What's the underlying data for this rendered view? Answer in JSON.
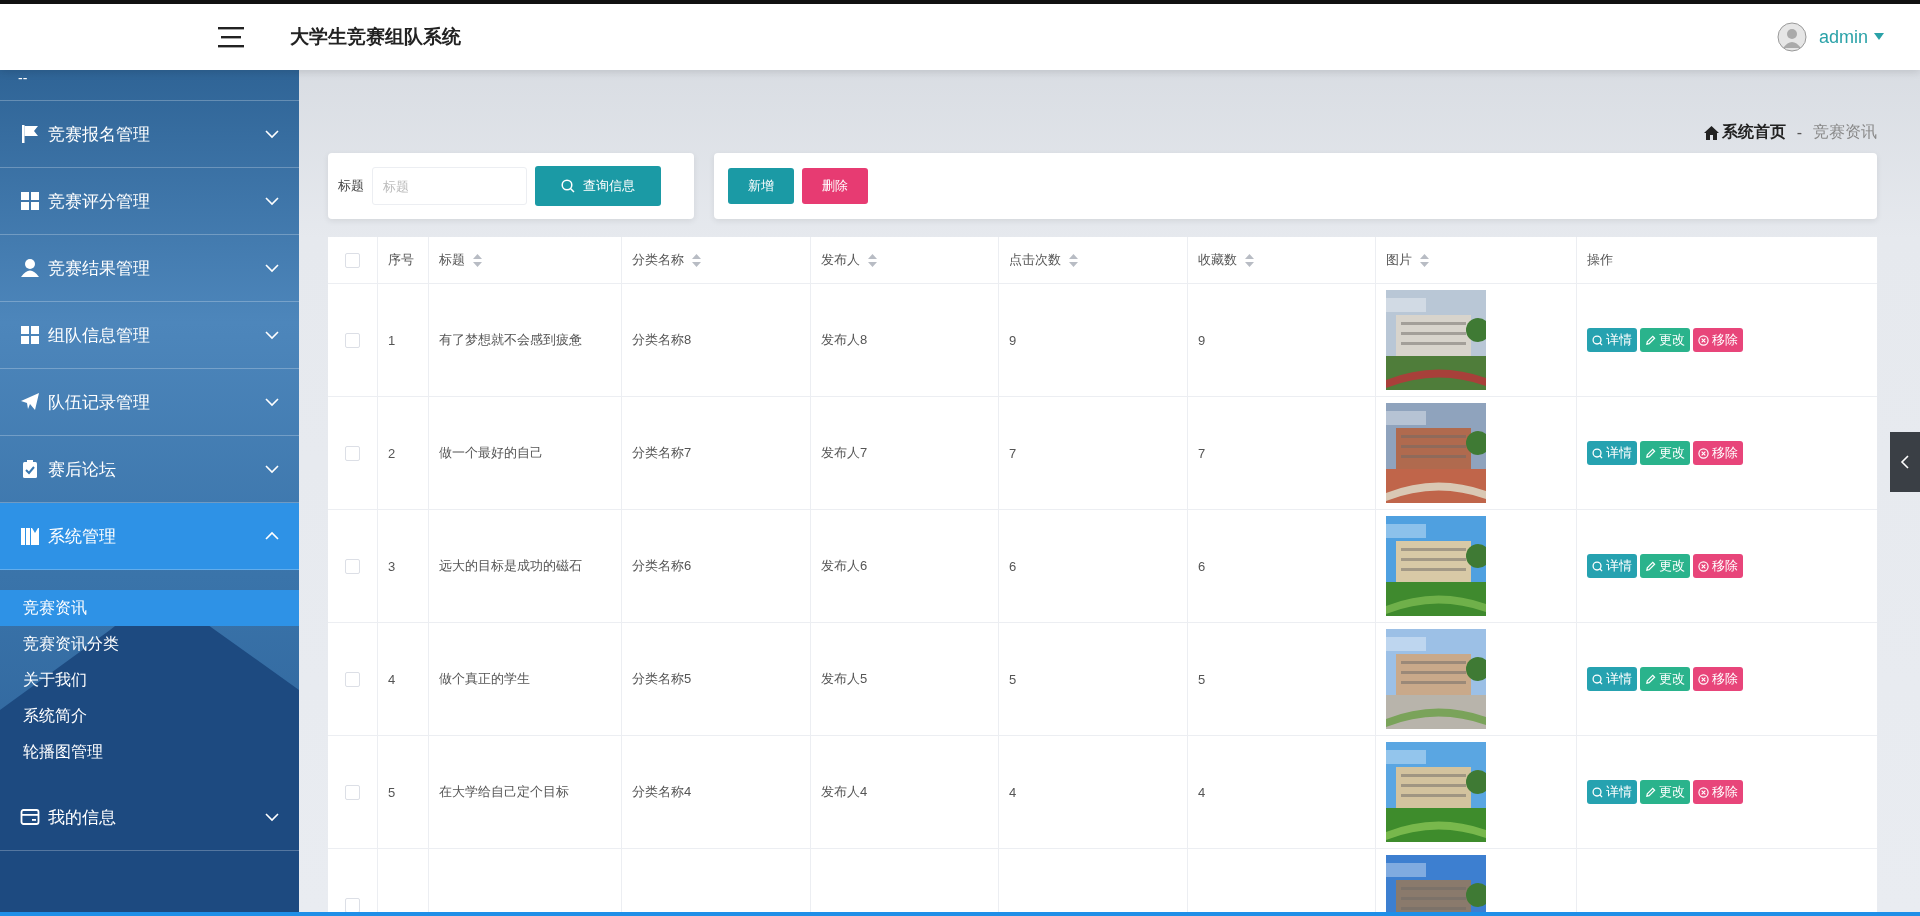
{
  "header": {
    "title": "大学生竞赛组队系统",
    "user": "admin"
  },
  "sidebar": {
    "top_label": "--",
    "items": [
      {
        "label": "竞赛报名管理",
        "expanded": false
      },
      {
        "label": "竞赛评分管理",
        "expanded": false
      },
      {
        "label": "竞赛结果管理",
        "expanded": false
      },
      {
        "label": "组队信息管理",
        "expanded": false
      },
      {
        "label": "队伍记录管理",
        "expanded": false
      },
      {
        "label": "赛后论坛",
        "expanded": false
      },
      {
        "label": "系统管理",
        "expanded": true,
        "children": [
          {
            "label": "竞赛资讯",
            "selected": true
          },
          {
            "label": "竞赛资讯分类",
            "selected": false
          },
          {
            "label": "关于我们",
            "selected": false
          },
          {
            "label": "系统简介",
            "selected": false
          },
          {
            "label": "轮播图管理",
            "selected": false
          }
        ]
      },
      {
        "label": "我的信息",
        "expanded": false
      }
    ]
  },
  "breadcrumb": {
    "home": "系统首页",
    "separator": "-",
    "current": "竞赛资讯"
  },
  "search": {
    "label": "标题",
    "placeholder": "标题",
    "button": "查询信息"
  },
  "actions": [
    {
      "label": "新增",
      "kind": "add"
    },
    {
      "label": "删除",
      "kind": "delete"
    }
  ],
  "table": {
    "all_checked": false,
    "columns": [
      {
        "label": "序号",
        "sortable": false
      },
      {
        "label": "标题",
        "sortable": true
      },
      {
        "label": "分类名称",
        "sortable": true
      },
      {
        "label": "发布人",
        "sortable": true
      },
      {
        "label": "点击次数",
        "sortable": true
      },
      {
        "label": "收藏数",
        "sortable": true
      },
      {
        "label": "图片",
        "sortable": true
      },
      {
        "label": "操作",
        "sortable": false
      }
    ],
    "rows": [
      {
        "checked": false,
        "cells": [
          "1",
          "有了梦想就不会感到疲惫",
          "分类名称8",
          "发布人8",
          "9",
          "9"
        ],
        "actions": [
          {
            "label": "详情",
            "kind": "detail"
          },
          {
            "label": "更改",
            "kind": "edit"
          },
          {
            "label": "移除",
            "kind": "remove"
          }
        ]
      },
      {
        "checked": false,
        "cells": [
          "2",
          "做一个最好的自己",
          "分类名称7",
          "发布人7",
          "7",
          "7"
        ],
        "actions": [
          {
            "label": "详情",
            "kind": "detail"
          },
          {
            "label": "更改",
            "kind": "edit"
          },
          {
            "label": "移除",
            "kind": "remove"
          }
        ]
      },
      {
        "checked": false,
        "cells": [
          "3",
          "远大的目标是成功的磁石",
          "分类名称6",
          "发布人6",
          "6",
          "6"
        ],
        "actions": [
          {
            "label": "详情",
            "kind": "detail"
          },
          {
            "label": "更改",
            "kind": "edit"
          },
          {
            "label": "移除",
            "kind": "remove"
          }
        ]
      },
      {
        "checked": false,
        "cells": [
          "4",
          "做个真正的学生",
          "分类名称5",
          "发布人5",
          "5",
          "5"
        ],
        "actions": [
          {
            "label": "详情",
            "kind": "detail"
          },
          {
            "label": "更改",
            "kind": "edit"
          },
          {
            "label": "移除",
            "kind": "remove"
          }
        ]
      },
      {
        "checked": false,
        "cells": [
          "5",
          "在大学给自己定个目标",
          "分类名称4",
          "发布人4",
          "4",
          "4"
        ],
        "actions": [
          {
            "label": "详情",
            "kind": "detail"
          },
          {
            "label": "更改",
            "kind": "edit"
          },
          {
            "label": "移除",
            "kind": "remove"
          }
        ]
      },
      {
        "checked": false,
        "cells": [],
        "actions": []
      }
    ]
  }
}
